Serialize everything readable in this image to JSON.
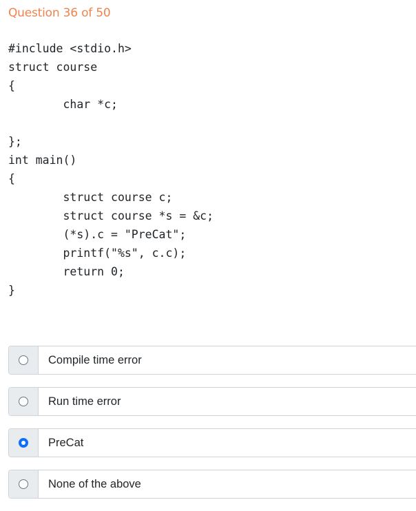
{
  "question": {
    "header": "Question 36 of 50"
  },
  "code": {
    "lines": [
      "#include <stdio.h>",
      "struct course",
      "{",
      "        char *c;",
      "",
      "};",
      "int main()",
      "{",
      "        struct course c;",
      "        struct course *s = &c;",
      "        (*s).c = \"PreCat\";",
      "        printf(\"%s\", c.c);",
      "        return 0;",
      "}"
    ]
  },
  "options": [
    {
      "label": "Compile time error",
      "selected": false
    },
    {
      "label": "Run time error",
      "selected": false
    },
    {
      "label": "PreCat",
      "selected": true
    },
    {
      "label": "None of the above",
      "selected": false
    }
  ],
  "colors": {
    "header": "#f0834d",
    "accent": "#0d6efd"
  }
}
